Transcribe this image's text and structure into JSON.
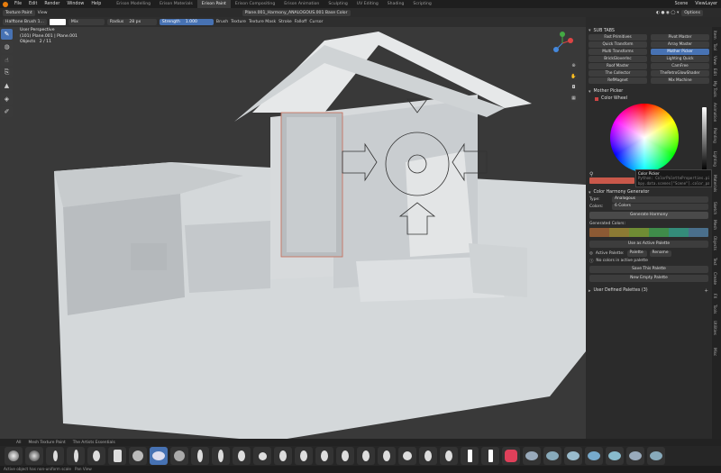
{
  "menubar": {
    "menus": [
      "File",
      "Edit",
      "Render",
      "Window",
      "Help"
    ],
    "workspaces": [
      "Erison Modelling",
      "Erison Materials",
      "Erison Paint",
      "Erison Compositing",
      "Erison Animation",
      "Sculpting",
      "UV Editing",
      "Shading",
      "Scripting"
    ],
    "active_workspace": "Erison Paint",
    "scene_label": "Scene",
    "view_layer_label": "ViewLayer"
  },
  "header1": {
    "mode": "Texture Paint",
    "view": "View",
    "object_path": "Plane.001_Harmony_ANALOGOUS.001 Base Color",
    "options": "Options"
  },
  "header2": {
    "brush": "Halftone Brush 1...",
    "blend": "Mix",
    "radius_label": "Radius",
    "radius_value": "28 px",
    "strength_label": "Strength",
    "strength_value": "1.000",
    "menus": [
      "Brush",
      "Texture",
      "Texture Mask",
      "Stroke",
      "Falloff",
      "Cursor"
    ]
  },
  "viewport_info": {
    "line1": "User Perspective",
    "line2": "(101) Plane.001 | Plane.001",
    "objects_label": "Objects",
    "objects_value": "2 / 11"
  },
  "panel": {
    "subtabs_title": "SUB TABS",
    "subtabs": [
      "Fast Primitives",
      "Pivot Master",
      "Quick Transform",
      "Array Master",
      "Multi Transforms",
      "Mother Picker",
      "BrickGloverInc",
      "Lighting Quick",
      "Roof Master",
      "CamFree",
      "The Collector",
      "TheRetroGlowShader",
      "RefMagnet",
      "Mix Machine"
    ],
    "active_subtab": "Mother Picker",
    "mother_picker_title": "Mother Picker",
    "color_wheel_label": "Color Wheel",
    "tooltip_title": "Color Picker",
    "tooltip_line1": "Python: ColorPaletteProperties.pick",
    "tooltip_line2": "bpy.data.scenes[\"Scene\"].color_pal...",
    "harmony_title": "Color Harmony Generator",
    "type_label": "Type:",
    "type_value": "Analogous",
    "colors_label": "Colors:",
    "colors_value": "6 Colors",
    "generate_button": "Generate Harmony",
    "generated_label": "Generated Colors:",
    "use_active_button": "Use as Active Palette",
    "active_palette_label": "Active Palette:",
    "palette_name": "Palette",
    "rename_button": "Rename",
    "no_colors_msg": "No colors in active palette",
    "save_button": "Save This Palette",
    "new_empty_button": "New Empty Palette",
    "user_defined_label": "User Defined Palettes (3)"
  },
  "vertical_tabs": [
    "Item",
    "Tool",
    "View",
    "Edit",
    "My Tools",
    "Animation",
    "Painting",
    "Lighting",
    "Materials",
    "Sketch",
    "Mesh",
    "Objects",
    "Text",
    "Create",
    "FX",
    "Tools",
    "Utilities",
    "Misc"
  ],
  "brushbar": {
    "tabs": [
      "All",
      "Mesh Texture Paint",
      "The Artists Essentials"
    ]
  },
  "status": {
    "text": "Active object has non-uniform scale",
    "mode": "Pan View"
  },
  "colors": {
    "accent": "#4772b3",
    "generated": [
      "#8c5a34",
      "#8c7a34",
      "#6f8c34",
      "#3f8c4a",
      "#348c7a",
      "#4a6f8c"
    ],
    "swatch_picked": "#c9584a",
    "white_swatch": "#ffffff"
  }
}
